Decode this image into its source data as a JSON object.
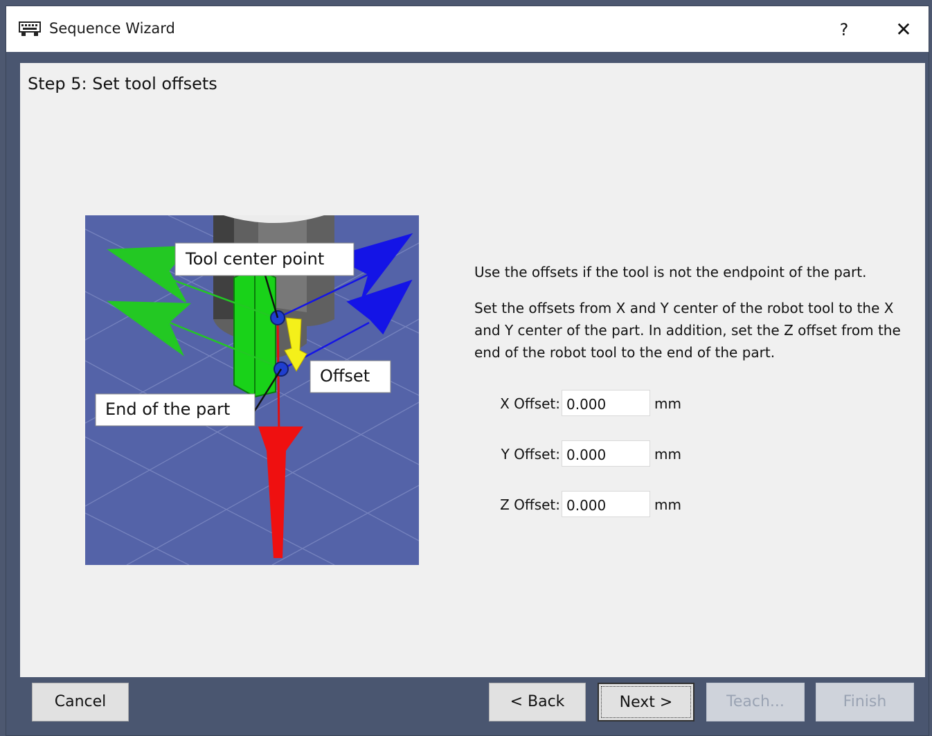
{
  "window": {
    "title": "Sequence Wizard",
    "help_label": "?",
    "close_label": "✕"
  },
  "step_title": "Step 5: Set tool offsets",
  "illustration": {
    "tool_center_label": "Tool center point",
    "offset_label": "Offset",
    "end_label": "End of the part"
  },
  "description": {
    "p1": "Use the offsets if the tool is not the endpoint of the part.",
    "p2": "Set the offsets from X and Y center of the robot tool to the X and Y center of the part.  In addition, set the Z offset from the end of the robot tool to the end of the part."
  },
  "offsets": [
    {
      "label": "X Offset:",
      "value": "0.000",
      "unit": "mm"
    },
    {
      "label": "Y Offset:",
      "value": "0.000",
      "unit": "mm"
    },
    {
      "label": "Z Offset:",
      "value": "0.000",
      "unit": "mm"
    }
  ],
  "buttons": {
    "cancel": "Cancel",
    "back": "< Back",
    "next": "Next >",
    "teach": "Teach...",
    "finish": "Finish"
  },
  "icons": {
    "window": "window-icon",
    "help": "question-mark",
    "close": "x-close"
  }
}
